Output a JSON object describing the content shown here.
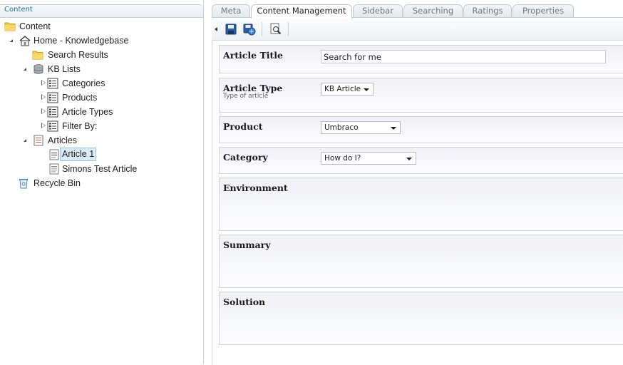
{
  "tree": {
    "header": "Content",
    "items": [
      {
        "label": "Content",
        "icon": "folder-icon"
      },
      {
        "label": "Home - Knowledgebase",
        "icon": "house-icon"
      },
      {
        "label": "Search Results",
        "icon": "folder-icon"
      },
      {
        "label": "KB Lists",
        "icon": "database-icon"
      },
      {
        "label": "Categories",
        "icon": "list-icon"
      },
      {
        "label": "Products",
        "icon": "list-icon"
      },
      {
        "label": "Article Types",
        "icon": "list-icon"
      },
      {
        "label": "Filter By:",
        "icon": "list-icon"
      },
      {
        "label": "Articles",
        "icon": "articles-icon"
      },
      {
        "label": "Article 1",
        "icon": "document-icon",
        "selected": true
      },
      {
        "label": "Simons Test Article",
        "icon": "document-icon"
      },
      {
        "label": "Recycle Bin",
        "icon": "recycle-bin-icon"
      }
    ]
  },
  "tabs": [
    "Meta",
    "Content Management",
    "Sidebar",
    "Searching",
    "Ratings",
    "Properties"
  ],
  "active_tab": "Content Management",
  "toolbar": {
    "buttons": [
      "save-icon",
      "save-and-publish-icon",
      "preview-icon"
    ]
  },
  "form": {
    "article_title": {
      "label": "Article Title",
      "value": "Search for me"
    },
    "article_type": {
      "label": "Article Type",
      "description": "Type of article",
      "value": "KB Article"
    },
    "product": {
      "label": "Product",
      "value": "Umbraco"
    },
    "category": {
      "label": "Category",
      "value": "How do I?"
    },
    "environment": {
      "label": "Environment"
    },
    "summary": {
      "label": "Summary"
    },
    "solution": {
      "label": "Solution"
    }
  },
  "colors": {
    "tab_inactive_text": "#6f7a85",
    "header_text": "#2f6f8f",
    "row_background": "#f0f1f7",
    "selection": "#dbeaf7"
  }
}
